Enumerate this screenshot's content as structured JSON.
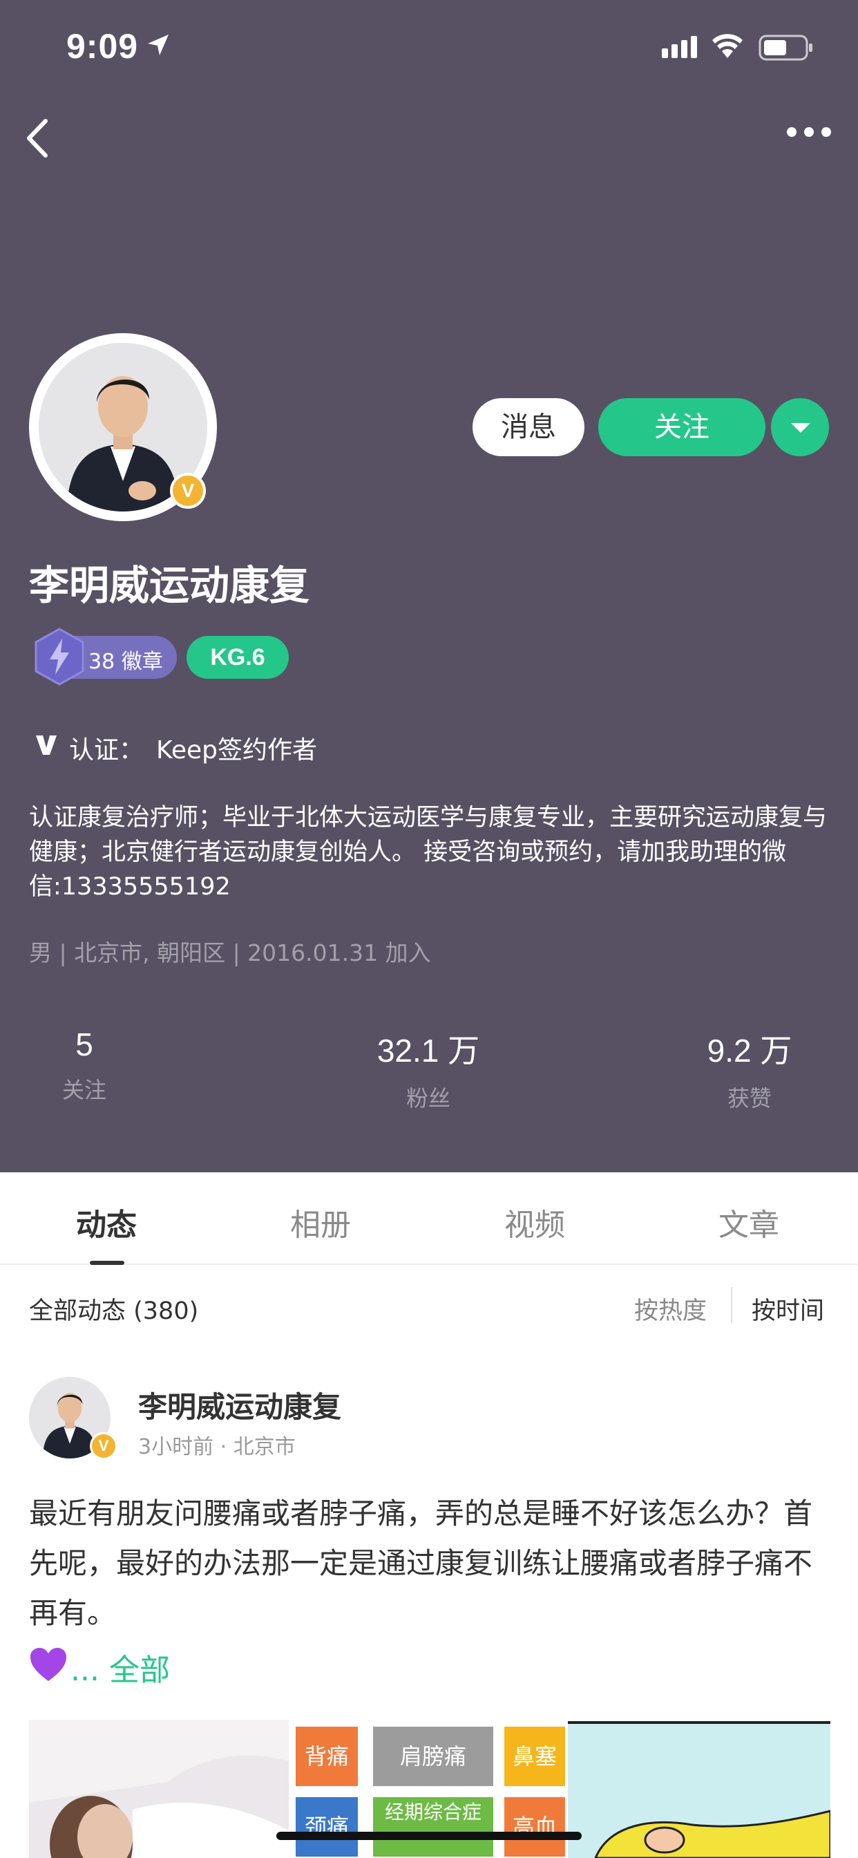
{
  "status_bar": {
    "time": "9:09"
  },
  "profile": {
    "name": "李明威运动康复",
    "verified_badge": "V",
    "badges_label": "38 徽章",
    "level": "KG.6",
    "cert_label": "认证：",
    "cert_value": "Keep签约作者",
    "bio": "认证康复治疗师；毕业于北体大运动医学与康复专业，主要研究运动康复与健康；北京健行者运动康复创始人。 接受咨询或预约，请加我助理的微信:13335555192",
    "meta": "男 | 北京市, 朝阳区 | 2016.01.31 加入"
  },
  "actions": {
    "message": "消息",
    "follow": "关注"
  },
  "stats": [
    {
      "value": "5",
      "label": "关注"
    },
    {
      "value": "32.1 万",
      "label": "粉丝"
    },
    {
      "value": "9.2 万",
      "label": "获赞"
    }
  ],
  "tabs": [
    "动态",
    "相册",
    "视频",
    "文章"
  ],
  "feed": {
    "title": "全部动态 (380)",
    "sort_hot": "按热度",
    "sort_time": "按时间"
  },
  "post": {
    "author": "李明威运动康复",
    "meta": "3小时前 · 北京市",
    "text": "最近有朋友问腰痛或者脖子痛，弄的总是睡不好该怎么办？首先呢，最好的办法那一定是通过康复训练让腰痛或者脖子痛不再有。",
    "more": "... 全部",
    "grid": [
      "背痛",
      "肩膀痛",
      "鼻塞",
      "颈痛",
      "经期综合症",
      "高血压"
    ]
  },
  "colors": {
    "header_bg": "#585163",
    "accent_green": "#24c789",
    "badge_purple": "#7770bf",
    "verify_gold": "#f2b431"
  }
}
